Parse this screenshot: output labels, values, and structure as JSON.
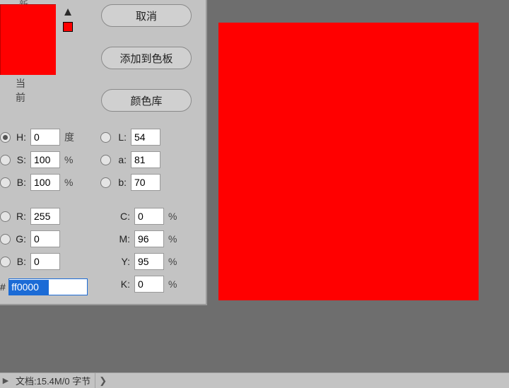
{
  "canvas": {
    "color": "#ff0000"
  },
  "dialog": {
    "btn_cancel": "取消",
    "btn_add_swatch": "添加到色板",
    "btn_color_lib": "颜色库",
    "prev_label": "新的",
    "cur_label": "当前",
    "hsb": {
      "h_label": "H:",
      "h": "0",
      "h_unit": "度",
      "s_label": "S:",
      "s": "100",
      "s_unit": "%",
      "b_label": "B:",
      "b": "100",
      "b_unit": "%"
    },
    "lab": {
      "l_label": "L:",
      "l": "54",
      "a_label": "a:",
      "a": "81",
      "b_label": "b:",
      "b": "70"
    },
    "rgb": {
      "r_label": "R:",
      "r": "255",
      "g_label": "G:",
      "g": "0",
      "b_label": "B:",
      "b": "0"
    },
    "cmyk": {
      "c_label": "C:",
      "c": "0",
      "m_label": "M:",
      "m": "96",
      "y_label": "Y:",
      "y": "95",
      "k_label": "K:",
      "k": "0",
      "pct": "%"
    },
    "hex_prefix": "#",
    "hex": "ff0000"
  },
  "status": {
    "doc": "文档:15.4M/0 字节",
    "tri": "▶",
    "chev": "❯"
  }
}
